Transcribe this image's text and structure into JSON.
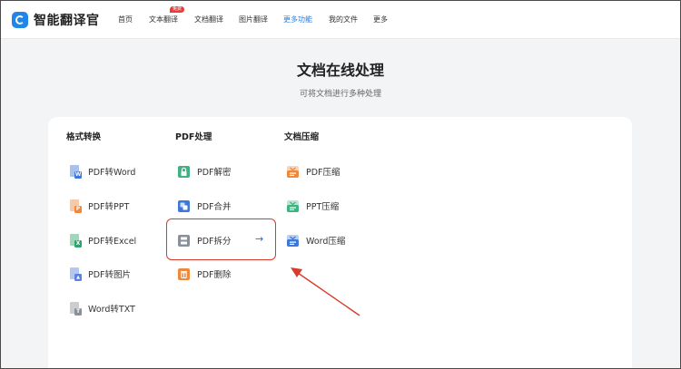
{
  "header": {
    "logo_text": "智能翻译官",
    "nav": [
      {
        "label": "首页"
      },
      {
        "label": "文本翻译",
        "badge": "免费"
      },
      {
        "label": "文档翻译"
      },
      {
        "label": "图片翻译"
      },
      {
        "label": "更多功能",
        "active": true
      },
      {
        "label": "我的文件"
      },
      {
        "label": "更多"
      }
    ]
  },
  "page": {
    "title": "文档在线处理",
    "subtitle": "可将文档进行多种处理"
  },
  "columns": [
    {
      "heading": "格式转换",
      "items": [
        {
          "label": "PDF转Word",
          "icon": "word-file-icon",
          "tag": "W",
          "color": "#3d78d8"
        },
        {
          "label": "PDF转PPT",
          "icon": "ppt-file-icon",
          "tag": "P",
          "color": "#f0883a"
        },
        {
          "label": "PDF转Excel",
          "icon": "excel-file-icon",
          "tag": "X",
          "color": "#2ea36b"
        },
        {
          "label": "PDF转图片",
          "icon": "image-file-icon",
          "tag": "▲",
          "color": "#5b82e0"
        },
        {
          "label": "Word转TXT",
          "icon": "txt-file-icon",
          "tag": "T",
          "color": "#8a9099"
        }
      ]
    },
    {
      "heading": "PDF处理",
      "items": [
        {
          "label": "PDF解密",
          "icon": "unlock-icon",
          "color": "#3fb27f"
        },
        {
          "label": "PDF合并",
          "icon": "merge-icon",
          "color": "#3d78d8"
        },
        {
          "label": "PDF拆分",
          "icon": "split-icon",
          "color": "#8a9099",
          "selected": true
        },
        {
          "label": "PDF删除",
          "icon": "delete-page-icon",
          "color": "#f0883a"
        }
      ]
    },
    {
      "heading": "文档压缩",
      "items": [
        {
          "label": "PDF压缩",
          "icon": "pdf-compress-icon",
          "color": "#f0883a"
        },
        {
          "label": "PPT压缩",
          "icon": "ppt-compress-icon",
          "color": "#3fb27f"
        },
        {
          "label": "Word压缩",
          "icon": "word-compress-icon",
          "color": "#3d78d8"
        }
      ]
    }
  ],
  "selected_arrow": "→",
  "colors": {
    "accent": "#2a7de1",
    "highlight_border": "#d83b2b",
    "annotation_arrow": "#d83b2b",
    "badge": "#ea3b3b"
  }
}
